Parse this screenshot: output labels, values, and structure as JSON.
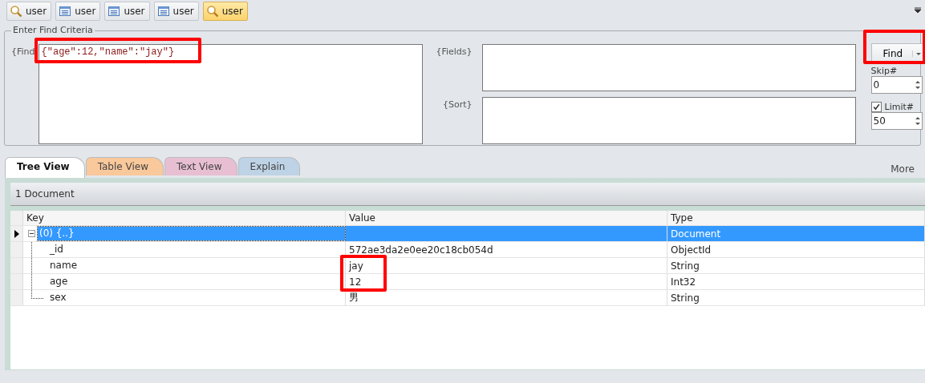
{
  "doc_tabs": [
    {
      "label": "user",
      "kind": "find",
      "selected": false
    },
    {
      "label": "user",
      "kind": "table",
      "selected": false
    },
    {
      "label": "user",
      "kind": "table",
      "selected": false
    },
    {
      "label": "user",
      "kind": "table",
      "selected": false
    },
    {
      "label": "user",
      "kind": "find",
      "selected": true
    }
  ],
  "criteria": {
    "legend": "Enter Find Criteria",
    "find_label": "{Find",
    "find_value": "{\"age\":12,\"name\":\"jay\"}",
    "fields_label": "{Fields}",
    "sort_label": "{Sort}",
    "find_button": "Find",
    "skip_label": "Skip#",
    "skip_value": "0",
    "limit_label": "Limit#",
    "limit_checked": true,
    "limit_value": "50"
  },
  "view_tabs": [
    {
      "label": "Tree View",
      "color": "#ffffff",
      "selected": true
    },
    {
      "label": "Table View",
      "color": "#f9c89b",
      "selected": false
    },
    {
      "label": "Text View",
      "color": "#e8bfd2",
      "selected": false
    },
    {
      "label": "Explain",
      "color": "#bfd3e6",
      "selected": false
    }
  ],
  "more": "More",
  "result_count": "1 Document",
  "table": {
    "columns": [
      "Key",
      "Value",
      "Type"
    ],
    "rows": [
      {
        "key": "(0) {..}",
        "value": "",
        "type": "Document",
        "selected": true,
        "expanded": true,
        "children": [
          {
            "key": "_id",
            "value": "572ae3da2e0ee20c18cb054d",
            "type": "ObjectId",
            "selected": false
          },
          {
            "key": "name",
            "value": "jay",
            "type": "String",
            "selected": false
          },
          {
            "key": "age",
            "value": "12",
            "type": "Int32",
            "selected": false
          },
          {
            "key": "sex",
            "value": "男",
            "type": "String",
            "selected": false
          }
        ]
      }
    ]
  }
}
